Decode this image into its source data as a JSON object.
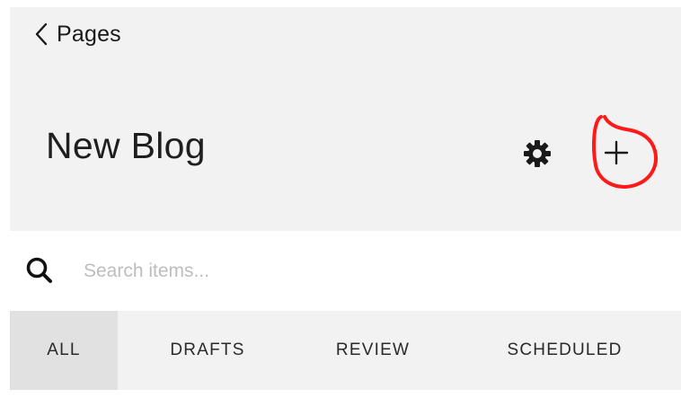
{
  "header": {
    "back_label": "Pages",
    "title": "New Blog",
    "settings_icon": "gear-icon",
    "add_icon": "plus-icon"
  },
  "search": {
    "placeholder": "Search items...",
    "value": ""
  },
  "tabs": [
    {
      "label": "ALL",
      "active": true
    },
    {
      "label": "DRAFTS",
      "active": false
    },
    {
      "label": "REVIEW",
      "active": false
    },
    {
      "label": "SCHEDULED",
      "active": false
    }
  ],
  "colors": {
    "header_bg": "#f2f2f2",
    "active_tab_bg": "#e1e1e1",
    "annotation": "#ff1a1a",
    "text": "#1f1f1f",
    "placeholder": "#bdbdbd"
  }
}
